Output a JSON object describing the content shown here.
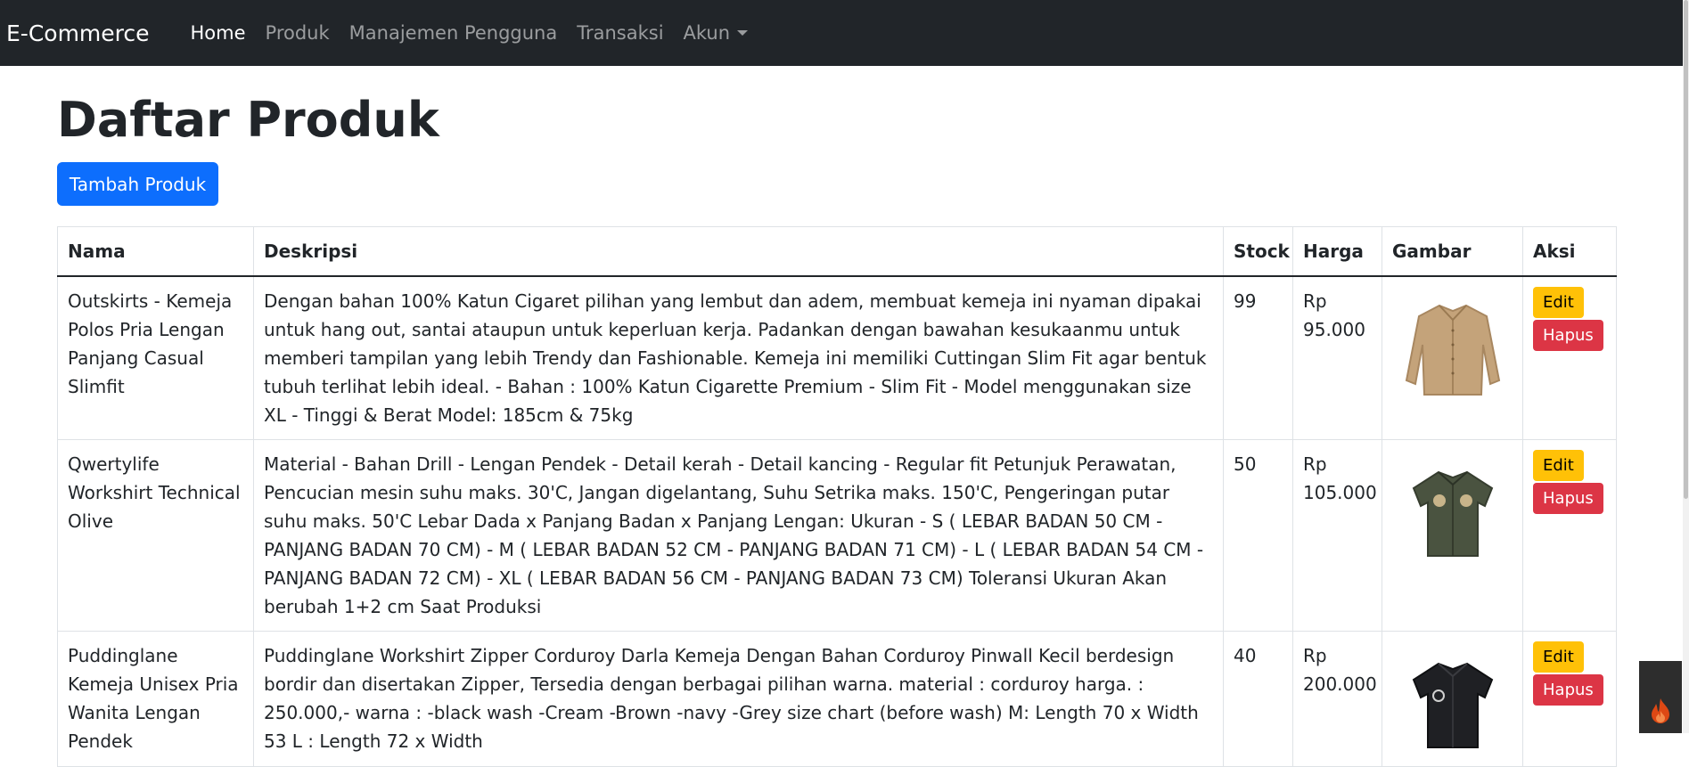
{
  "navbar": {
    "brand": "E-Commerce",
    "links": [
      "Home",
      "Produk",
      "Manajemen Pengguna",
      "Transaksi",
      "Akun"
    ]
  },
  "page": {
    "title": "Daftar Produk",
    "add_button": "Tambah Produk"
  },
  "table": {
    "headers": [
      "Nama",
      "Deskripsi",
      "Stock",
      "Harga",
      "Gambar",
      "Aksi"
    ],
    "rows": [
      {
        "nama": "Outskirts - Kemeja Polos Pria Lengan Panjang Casual Slimfit",
        "deskripsi": "Dengan bahan 100% Katun Cigaret pilihan yang lembut dan adem, membuat kemeja ini nyaman dipakai untuk hang out, santai ataupun untuk keperluan kerja. Padankan dengan bawahan kesukaanmu untuk memberi tampilan yang lebih Trendy dan Fashionable. Kemeja ini memiliki Cuttingan Slim Fit agar bentuk tubuh terlihat lebih ideal. - Bahan : 100% Katun Cigarette Premium - Slim Fit - Model menggunakan size XL - Tinggi & Berat Model: 185cm & 75kg",
        "stock": "99",
        "harga": "Rp 95.000",
        "edit": "Edit",
        "hapus": "Hapus"
      },
      {
        "nama": "Qwertylife Workshirt Technical Olive",
        "deskripsi": "Material - Bahan Drill - Lengan Pendek - Detail kerah - Detail kancing - Regular fit Petunjuk Perawatan, Pencucian mesin suhu maks. 30'C, Jangan digelantang, Suhu Setrika maks. 150'C, Pengeringan putar suhu maks. 50'C Lebar Dada x Panjang Badan x Panjang Lengan: Ukuran - S ( LEBAR BADAN 50 CM - PANJANG BADAN 70 CM) - M ( LEBAR BADAN 52 CM - PANJANG BADAN 71 CM) - L ( LEBAR BADAN 54 CM - PANJANG BADAN 72 CM) - XL ( LEBAR BADAN 56 CM - PANJANG BADAN 73 CM) Toleransi Ukuran Akan berubah 1+2 cm Saat Produksi",
        "stock": "50",
        "harga": "Rp 105.000",
        "edit": "Edit",
        "hapus": "Hapus"
      },
      {
        "nama": "Puddinglane Kemeja Unisex Pria Wanita Lengan Pendek",
        "deskripsi": "Puddinglane Workshirt Zipper Corduroy Darla Kemeja Dengan Bahan Corduroy Pinwall Kecil berdesign bordir dan disertakan Zipper, Tersedia dengan berbagai pilihan warna. material : corduroy harga. : 250.000,- warna : -black wash -Cream -Brown -navy -Grey size chart (before wash) M: Length 70 x Width 53 L : Length 72 x Width",
        "stock": "40",
        "harga": "Rp 200.000",
        "edit": "Edit",
        "hapus": "Hapus"
      }
    ]
  },
  "colors": {
    "navbar_bg": "#212529",
    "primary": "#0d6efd",
    "warning": "#ffc107",
    "danger": "#dc3545",
    "shirt_khaki": "#c4a37a",
    "shirt_olive": "#4a5340",
    "shirt_black": "#1f2024"
  },
  "icons": {
    "dropdown": "caret-down-icon",
    "debug_toolbar": "flame-icon"
  }
}
